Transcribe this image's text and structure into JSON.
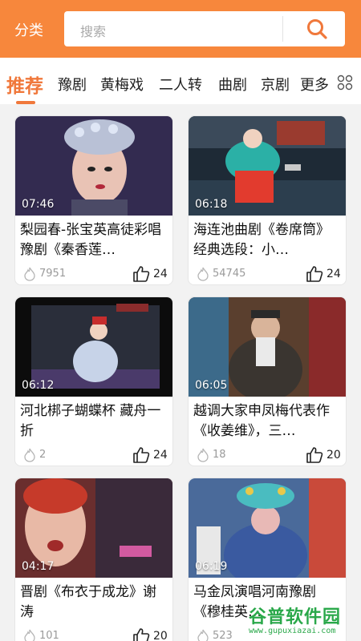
{
  "header": {
    "category_label": "分类",
    "search_placeholder": "搜索"
  },
  "tabs": [
    {
      "label": "推荐",
      "active": true
    },
    {
      "label": "豫剧"
    },
    {
      "label": "黄梅戏"
    },
    {
      "label": "二人转"
    },
    {
      "label": "曲剧"
    },
    {
      "label": "京剧"
    },
    {
      "label": "更多"
    }
  ],
  "videos": [
    {
      "duration": "07:46",
      "title": "梨园春-张宝英高徒彩唱豫剧《秦香莲…",
      "views": "7951",
      "likes": "24"
    },
    {
      "duration": "06:18",
      "title": "海连池曲剧《卷席筒》经典选段：小…",
      "views": "54745",
      "likes": "24"
    },
    {
      "duration": "06:12",
      "title": "河北梆子蝴蝶杯 藏舟一折",
      "views": "2",
      "likes": "24"
    },
    {
      "duration": "06:05",
      "title": "越调大家申凤梅代表作《收姜维》，三…",
      "views": "18",
      "likes": "20"
    },
    {
      "duration": "04:17",
      "title": "晋剧《布衣于成龙》谢涛",
      "views": "101",
      "likes": "20"
    },
    {
      "duration": "06:19",
      "title": "马金凤演唱河南豫剧《穆桂英…",
      "views": "523",
      "likes": ""
    }
  ],
  "watermark": {
    "title": "谷普软件园",
    "url": "www.gupuxiazai.com"
  },
  "colors": {
    "header": "#f7873c",
    "accent": "#f0783b"
  }
}
